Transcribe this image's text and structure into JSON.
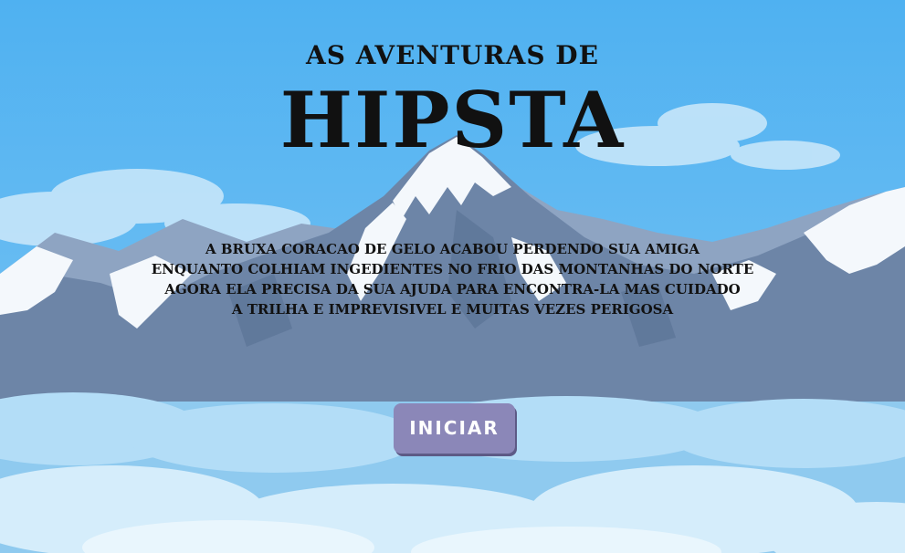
{
  "title": {
    "subtitle": "As Aventuras de",
    "main": "HIPSTA"
  },
  "story_lines": [
    "A bruxa coracao de gelo acabou perdendo sua amiga",
    "enquanto colhiam ingedientes no frio das montanhas do norte",
    "agora ela precisa da sua ajuda para encontra-la  mas cuidado",
    "a trilha e imprevisivel e muitas vezes perigosa"
  ],
  "start_button": {
    "label": "INICIAR"
  },
  "colors": {
    "sky": "#55b4f2",
    "mountain": "#6c86a8",
    "snow": "#ffffff",
    "clouds": "#a9d8f5",
    "button": "#8b87b8"
  }
}
